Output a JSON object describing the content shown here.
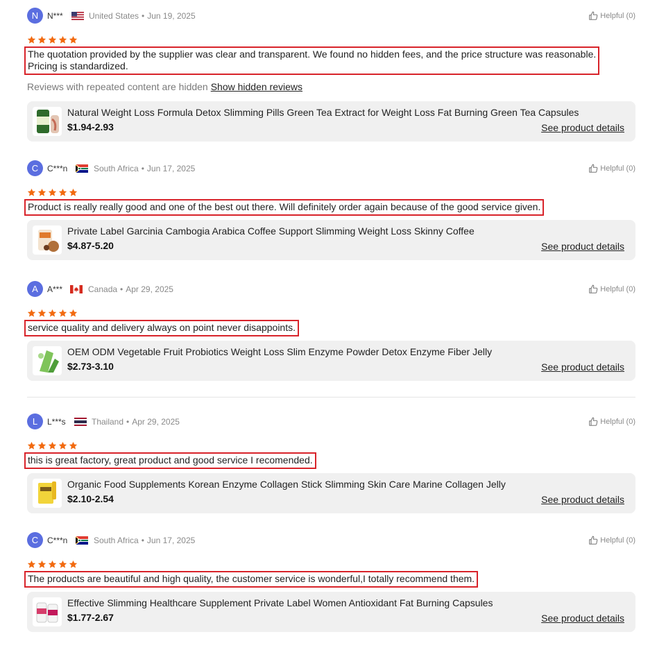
{
  "hidden_reviews": {
    "text": "Reviews with repeated content are hidden",
    "link": "Show hidden reviews"
  },
  "colors": {
    "star": "#f26a10",
    "highlight_border": "#d8232a",
    "avatar": "#5b6ee0"
  },
  "reviews": [
    {
      "initial": "N",
      "user": "N***",
      "country": "United States",
      "date": "Jun 19, 2025",
      "helpful": "Helpful (0)",
      "rating": 5,
      "comment_line1": "The quotation provided by the supplier was clear and transparent. We found no hidden fees, and the price structure was reasonable.",
      "comment_line2": "Pricing is standardized.",
      "product": {
        "name": "Natural Weight Loss Formula Detox Slimming Pills Green Tea Extract for Weight Loss Fat Burning Green Tea Capsules",
        "price": "$1.94-2.93",
        "link": "See product details"
      }
    },
    {
      "initial": "C",
      "user": "C***n",
      "country": "South Africa",
      "date": "Jun 17, 2025",
      "helpful": "Helpful (0)",
      "rating": 5,
      "comment_line1": "Product is really really good and one of the best out there. Will definitely order again because of the good service given.",
      "product": {
        "name": "Private Label Garcinia Cambogia Arabica Coffee Support Slimming Weight Loss Skinny Coffee",
        "price": "$4.87-5.20",
        "link": "See product details"
      }
    },
    {
      "initial": "A",
      "user": "A***",
      "country": "Canada",
      "date": "Apr 29, 2025",
      "helpful": "Helpful (0)",
      "rating": 5,
      "comment_line1": "service quality and delivery always on point never disappoints.",
      "product": {
        "name": "OEM ODM Vegetable Fruit Probiotics Weight Loss Slim Enzyme Powder Detox Enzyme Fiber Jelly",
        "price": "$2.73-3.10",
        "link": "See product details"
      }
    },
    {
      "initial": "L",
      "user": "L***s",
      "country": "Thailand",
      "date": "Apr 29, 2025",
      "helpful": "Helpful (0)",
      "rating": 5,
      "comment_line1": "this is great factory, great product and good service I recomended.",
      "product": {
        "name": "Organic Food Supplements Korean Enzyme Collagen Stick Slimming Skin Care Marine Collagen Jelly",
        "price": "$2.10-2.54",
        "link": "See product details"
      }
    },
    {
      "initial": "C",
      "user": "C***n",
      "country": "South Africa",
      "date": "Jun 17, 2025",
      "helpful": "Helpful (0)",
      "rating": 5,
      "comment_line1": "The products are beautiful and high quality, the customer service is wonderful,I totally recommend them.",
      "product": {
        "name": "Effective Slimming Healthcare Supplement Private Label Women Antioxidant Fat Burning Capsules",
        "price": "$1.77-2.67",
        "link": "See product details"
      }
    }
  ]
}
